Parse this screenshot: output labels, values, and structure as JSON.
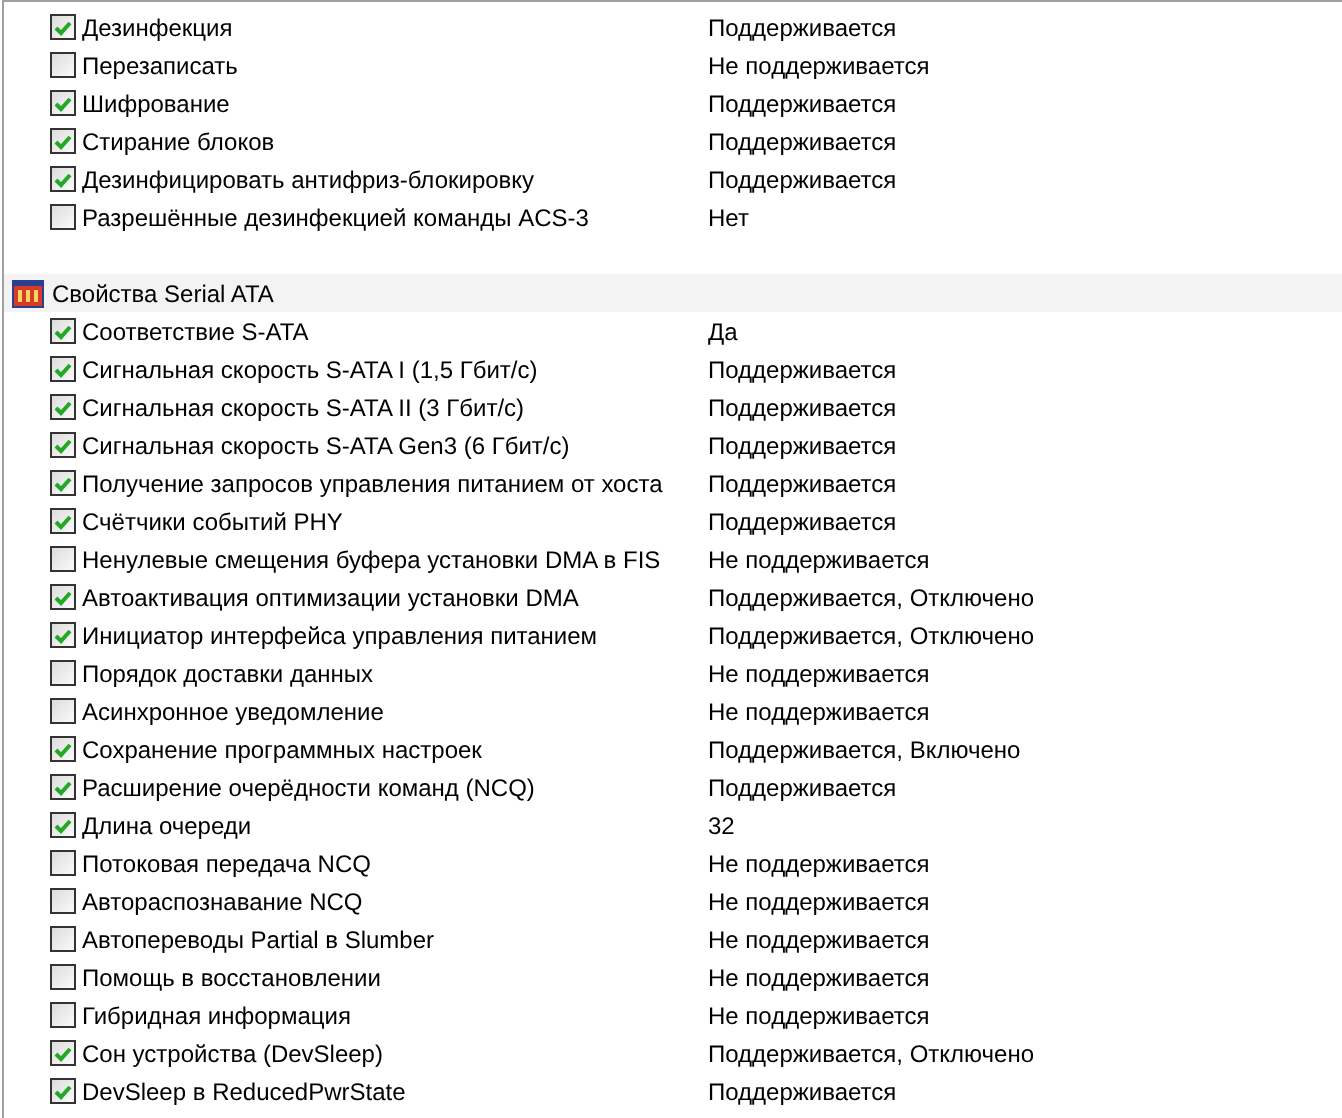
{
  "sections": [
    {
      "items": [
        {
          "label": "Дезинфекция",
          "checked": true,
          "value": "Поддерживается"
        },
        {
          "label": "Перезаписать",
          "checked": false,
          "value": "Не поддерживается"
        },
        {
          "label": "Шифрование",
          "checked": true,
          "value": "Поддерживается"
        },
        {
          "label": "Стирание блоков",
          "checked": true,
          "value": "Поддерживается"
        },
        {
          "label": "Дезинфицировать антифриз-блокировку",
          "checked": true,
          "value": "Поддерживается"
        },
        {
          "label": "Разрешённые дезинфекцией команды ACS-3",
          "checked": false,
          "value": "Нет"
        }
      ]
    },
    {
      "title": "Свойства Serial ATA",
      "items": [
        {
          "label": "Соответствие S-ATA",
          "checked": true,
          "value": "Да"
        },
        {
          "label": "Сигнальная скорость S-ATA I (1,5 Гбит/с)",
          "checked": true,
          "value": "Поддерживается"
        },
        {
          "label": "Сигнальная скорость S-ATA II (3 Гбит/с)",
          "checked": true,
          "value": "Поддерживается"
        },
        {
          "label": "Сигнальная скорость S-ATA Gen3 (6 Гбит/с)",
          "checked": true,
          "value": "Поддерживается"
        },
        {
          "label": "Получение запросов управления питанием от хоста",
          "checked": true,
          "value": "Поддерживается"
        },
        {
          "label": "Счётчики событий PHY",
          "checked": true,
          "value": "Поддерживается"
        },
        {
          "label": "Ненулевые смещения буфера установки DMA в FIS",
          "checked": false,
          "value": "Не поддерживается"
        },
        {
          "label": "Автоактивация оптимизации установки DMA",
          "checked": true,
          "value": "Поддерживается, Отключено"
        },
        {
          "label": "Инициатор интерфейса управления питанием",
          "checked": true,
          "value": "Поддерживается, Отключено"
        },
        {
          "label": "Порядок доставки данных",
          "checked": false,
          "value": "Не поддерживается"
        },
        {
          "label": "Асинхронное уведомление",
          "checked": false,
          "value": "Не поддерживается"
        },
        {
          "label": "Сохранение программных настроек",
          "checked": true,
          "value": "Поддерживается, Включено"
        },
        {
          "label": "Расширение очерёдности команд (NCQ)",
          "checked": true,
          "value": "Поддерживается"
        },
        {
          "label": "Длина очереди",
          "checked": true,
          "value": "32"
        },
        {
          "label": "Потоковая передача NCQ",
          "checked": false,
          "value": "Не поддерживается"
        },
        {
          "label": "Автораспознавание NCQ",
          "checked": false,
          "value": "Не поддерживается"
        },
        {
          "label": "Автопереводы Partial в Slumber",
          "checked": false,
          "value": "Не поддерживается"
        },
        {
          "label": "Помощь в восстановлении",
          "checked": false,
          "value": "Не поддерживается"
        },
        {
          "label": "Гибридная информация",
          "checked": false,
          "value": "Не поддерживается"
        },
        {
          "label": "Сон устройства (DevSleep)",
          "checked": true,
          "value": "Поддерживается, Отключено"
        },
        {
          "label": "DevSleep в ReducedPwrState",
          "checked": true,
          "value": "Поддерживается"
        }
      ]
    }
  ]
}
